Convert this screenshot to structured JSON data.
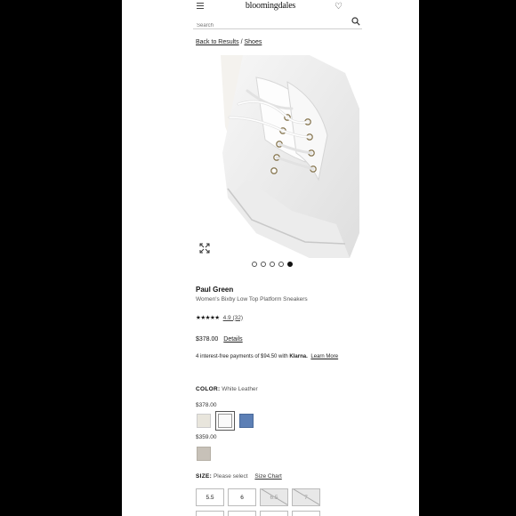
{
  "header": {
    "logo": "bloomingdales",
    "menu_icon": "hamburger-menu-icon",
    "heart_icon": "heart-icon"
  },
  "search": {
    "placeholder": "Search",
    "icon": "search-icon"
  },
  "breadcrumb": {
    "back": "Back to Results",
    "separator": "/",
    "category": "Shoes"
  },
  "gallery": {
    "image_count": 5,
    "active_index": 5,
    "expand_icon": "expand-icon"
  },
  "product": {
    "brand": "Paul Green",
    "name": "Women's Bixby Low Top Platform Sneakers",
    "stars": "★★★★★",
    "rating": 4.9,
    "rating_text": "4.9 (32)",
    "price": "$378.00",
    "details_link": "Details",
    "klarna_prefix": "4 interest-free payments of $94.50 with",
    "klarna_brand": "Klarna.",
    "klarna_link": "Learn More"
  },
  "color": {
    "label": "COLOR:",
    "selected": "White Leather",
    "price_group_1": "$378.00",
    "price_group_2": "$359.00",
    "swatch_colors": [
      "#e8e5dc",
      "#fafafa",
      "#5c7fb5",
      "#c7c1b8"
    ]
  },
  "size": {
    "label": "SIZE:",
    "prompt": "Please select",
    "chart_link": "Size Chart",
    "options": [
      {
        "label": "5.5",
        "available": true
      },
      {
        "label": "6",
        "available": true
      },
      {
        "label": "6.5",
        "available": false
      },
      {
        "label": "7",
        "available": false
      }
    ]
  }
}
